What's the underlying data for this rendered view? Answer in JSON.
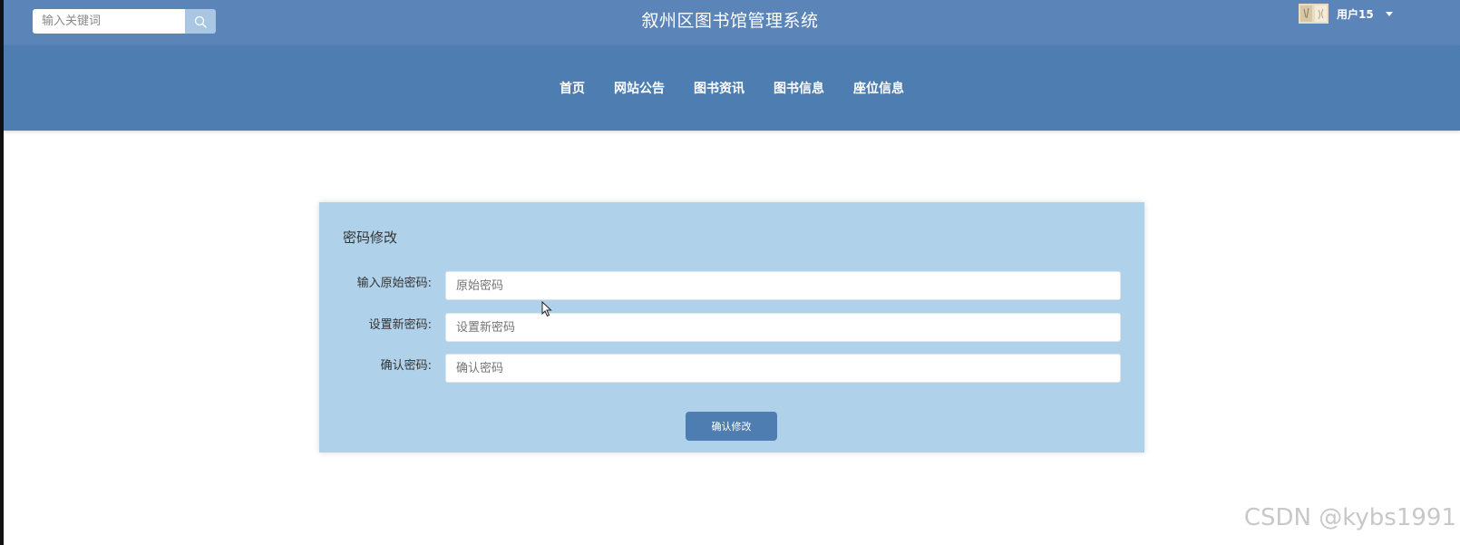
{
  "header": {
    "search": {
      "placeholder": "输入关键词",
      "value": "",
      "icon": "search-icon"
    },
    "site_title": "叙州区图书馆管理系统",
    "user": {
      "avatar": "avatar-image",
      "name": "用户15",
      "dropdown_icon": "caret-down-icon"
    }
  },
  "nav": {
    "items": [
      {
        "label": "首页"
      },
      {
        "label": "网站公告"
      },
      {
        "label": "图书资讯"
      },
      {
        "label": "图书信息"
      },
      {
        "label": "座位信息"
      }
    ]
  },
  "form": {
    "title": "密码修改",
    "fields": [
      {
        "label": "输入原始密码:",
        "placeholder": "原始密码",
        "value": ""
      },
      {
        "label": "设置新密码:",
        "placeholder": "设置新密码",
        "value": ""
      },
      {
        "label": "确认密码:",
        "placeholder": "确认密码",
        "value": ""
      }
    ],
    "submit_label": "确认修改"
  },
  "watermark": "CSDN @kybs1991",
  "colors": {
    "top_bar": "#5b84b8",
    "nav_bar": "#4e7db1",
    "card": "#afd2ea",
    "search_button": "#a9c7e3",
    "submit_button": "#4e7db1"
  }
}
